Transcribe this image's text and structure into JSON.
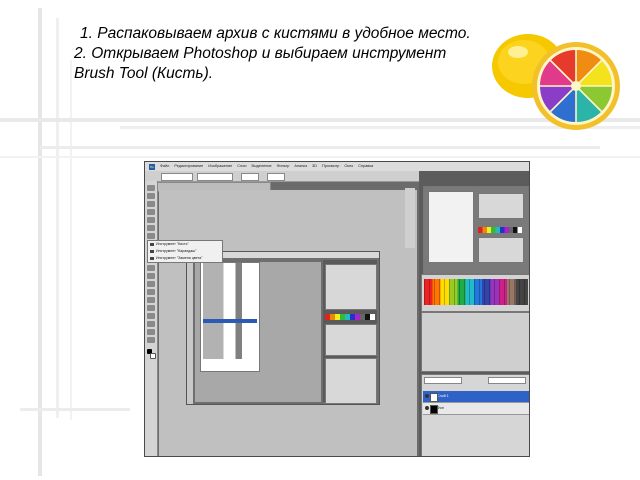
{
  "slide": {
    "line1": "1. Распаковываем архив с кистями в удобное место.",
    "line2": "2. Открываем Photoshop и выбираем инструмент",
    "line3": "Brush Tool (Кисть)."
  },
  "photoshop": {
    "menu": [
      "Файл",
      "Редактирование",
      "Изображение",
      "Слои",
      "Выделение",
      "Фильтр",
      "Анализ",
      "3D",
      "Просмотр",
      "Окно",
      "Справка"
    ],
    "tool_flyout": [
      "Инструмент \"Кисть\"",
      "Инструмент \"Карандаш\"",
      "Инструмент \"Замена цвета\""
    ],
    "layers": {
      "active_layer": "Слой 1",
      "background_layer": "Фон"
    }
  },
  "colors": {
    "text": "#000000",
    "selection_blue": "#2f62c6",
    "lemon_yellow": "#f3c400"
  }
}
